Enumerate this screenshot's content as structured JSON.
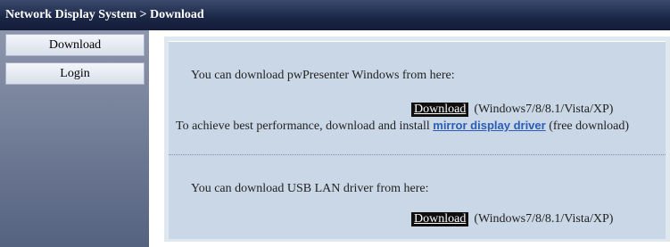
{
  "header": {
    "title": "Network Display System > Download"
  },
  "sidebar": {
    "items": [
      {
        "label": "Download"
      },
      {
        "label": "Login"
      }
    ]
  },
  "main": {
    "section1": {
      "intro": "You can download pwPresenter Windows from here:",
      "download_label": "Download",
      "os": "(Windows7/8/8.1/Vista/XP)",
      "perf_prefix": "To achieve best performance, download and install ",
      "link_label": "mirror display driver",
      "perf_suffix": " (free download)"
    },
    "section2": {
      "intro": "You can download USB LAN driver from here:",
      "download_label": "Download",
      "os": "(Windows7/8/8.1/Vista/XP)"
    }
  }
}
